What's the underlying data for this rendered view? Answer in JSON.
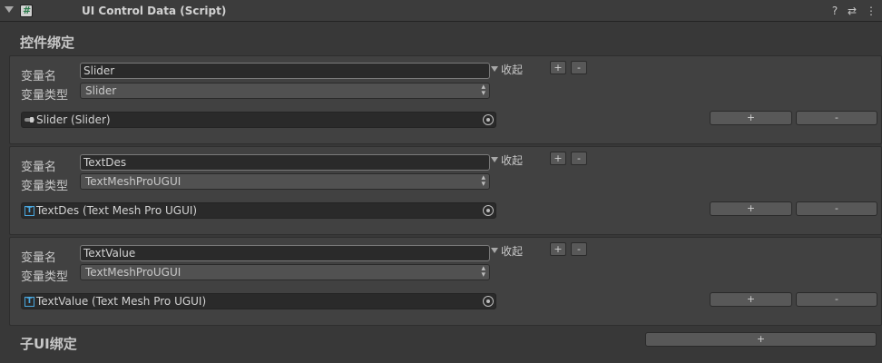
{
  "header": {
    "title": "UI Control Data (Script)",
    "icons": [
      "help-icon",
      "preset-icon",
      "menu-icon"
    ],
    "glyphs": {
      "help": "?",
      "preset": "⇄",
      "menu": "⋮",
      "script": "#"
    }
  },
  "sections": {
    "bindings_title": "控件绑定",
    "child_ui_title": "子UI绑定",
    "child_add_label": "+"
  },
  "labels": {
    "var_name": "变量名",
    "var_type": "变量类型",
    "collapse": "收起",
    "plus": "+",
    "minus": "-"
  },
  "entries": [
    {
      "name": "Slider",
      "type": "Slider",
      "object": "Slider (Slider)",
      "icon": "slider-icon"
    },
    {
      "name": "TextDes",
      "type": "TextMeshProUGUI",
      "object": "TextDes (Text Mesh Pro UGUI)",
      "icon": "textmeshpro-icon"
    },
    {
      "name": "TextValue",
      "type": "TextMeshProUGUI",
      "object": "TextValue (Text Mesh Pro UGUI)",
      "icon": "textmeshpro-icon"
    }
  ]
}
